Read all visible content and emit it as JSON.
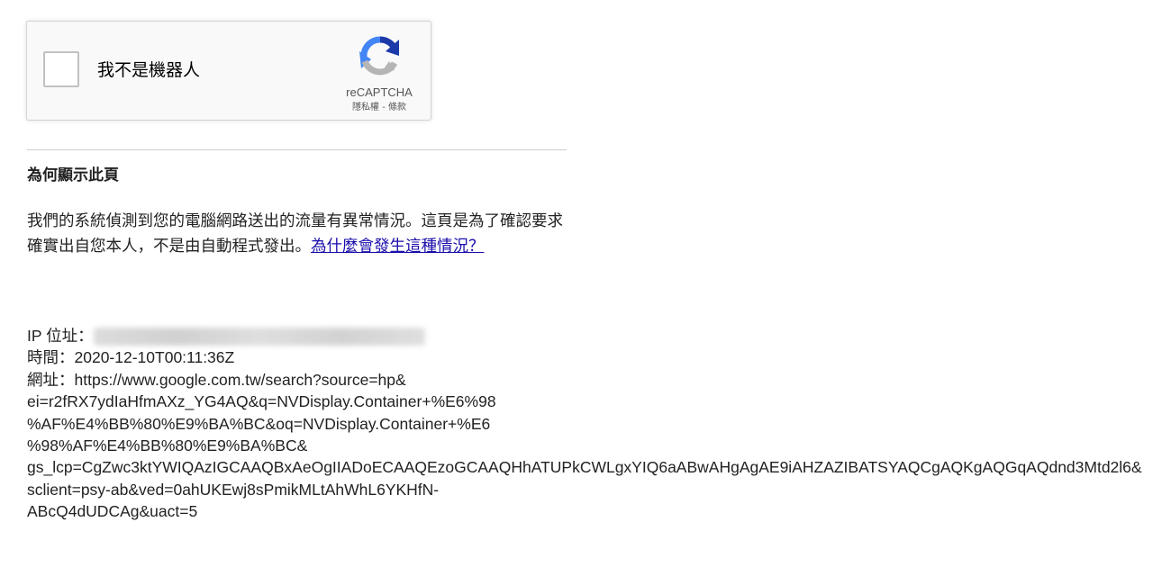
{
  "recaptcha": {
    "label": "我不是機器人",
    "brand": "reCAPTCHA",
    "privacy_link": "隱私權",
    "separator": " - ",
    "terms_link": "條款",
    "colors": {
      "blue": "#1c3aa9",
      "light_blue": "#4285f4",
      "gray": "#b5b5b5"
    },
    "icon": "recaptcha-logo-icon"
  },
  "why": {
    "title": "為何顯示此頁",
    "body": "我們的系統偵測到您的電腦網路送出的流量有異常情況。這頁是為了確認要求確實出自您本人，不是由自動程式發出。",
    "link": "為什麼會發生這種情況？"
  },
  "details": {
    "ip_label": "IP 位址：",
    "ip_value_blurred": "2001:b011:3803:8067:94bd:afb:557f:665a",
    "time_label": "時間：",
    "time_value": "2020-12-10T00:11:36Z",
    "url_label": "網址：",
    "url_lines": [
      "https://www.google.com.tw/search?source=hp&",
      "ei=r2fRX7ydIaHfmAXz_YG4AQ&q=NVDisplay.Container+%E6%98",
      "%AF%E4%BB%80%E9%BA%BC&oq=NVDisplay.Container+%E6",
      "%98%AF%E4%BB%80%E9%BA%BC&",
      "gs_lcp=CgZwc3ktYWIQAzIGCAAQBxAeOgIIADoECAAQEzoGCAAQHhATUPkCWLgxYIQ6aABwAHgAgAE9iAHZAZIBATSYAQCgAQKgAQGqAQdnd3Mtd2l6&",
      "sclient=psy-ab&ved=0ahUKEwj8sPmikMLtAhWhL6YKHfN-",
      "ABcQ4dUDCAg&uact=5"
    ]
  }
}
